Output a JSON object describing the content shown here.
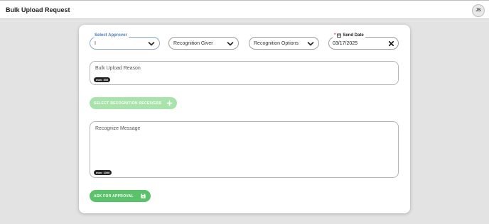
{
  "header": {
    "title": "Bulk Upload Request",
    "avatar_initials": "JS"
  },
  "form": {
    "approver": {
      "label": "Select Approver",
      "value": "I"
    },
    "recognition_giver": {
      "value": "Recognition Giver"
    },
    "recognition_options": {
      "value": "Recognition Options"
    },
    "send_date": {
      "label": "Send Date",
      "required_mark": "*",
      "value": "03/17/2025"
    },
    "reason": {
      "placeholder": "Bulk Upload Reason",
      "max_badge": "max: 300"
    },
    "receivers_button": {
      "label": "SELECT RECOGNITION RECEIVERS"
    },
    "message": {
      "placeholder": "Recognize Message",
      "max_badge": "max: 1000"
    },
    "approval_button": {
      "label": "ASK FOR APPROVAL"
    }
  },
  "colors": {
    "accent_green": "#59c26a",
    "disabled_green": "#a9e3ac",
    "label_blue": "#4a7bb7",
    "required_red": "#e02424"
  }
}
